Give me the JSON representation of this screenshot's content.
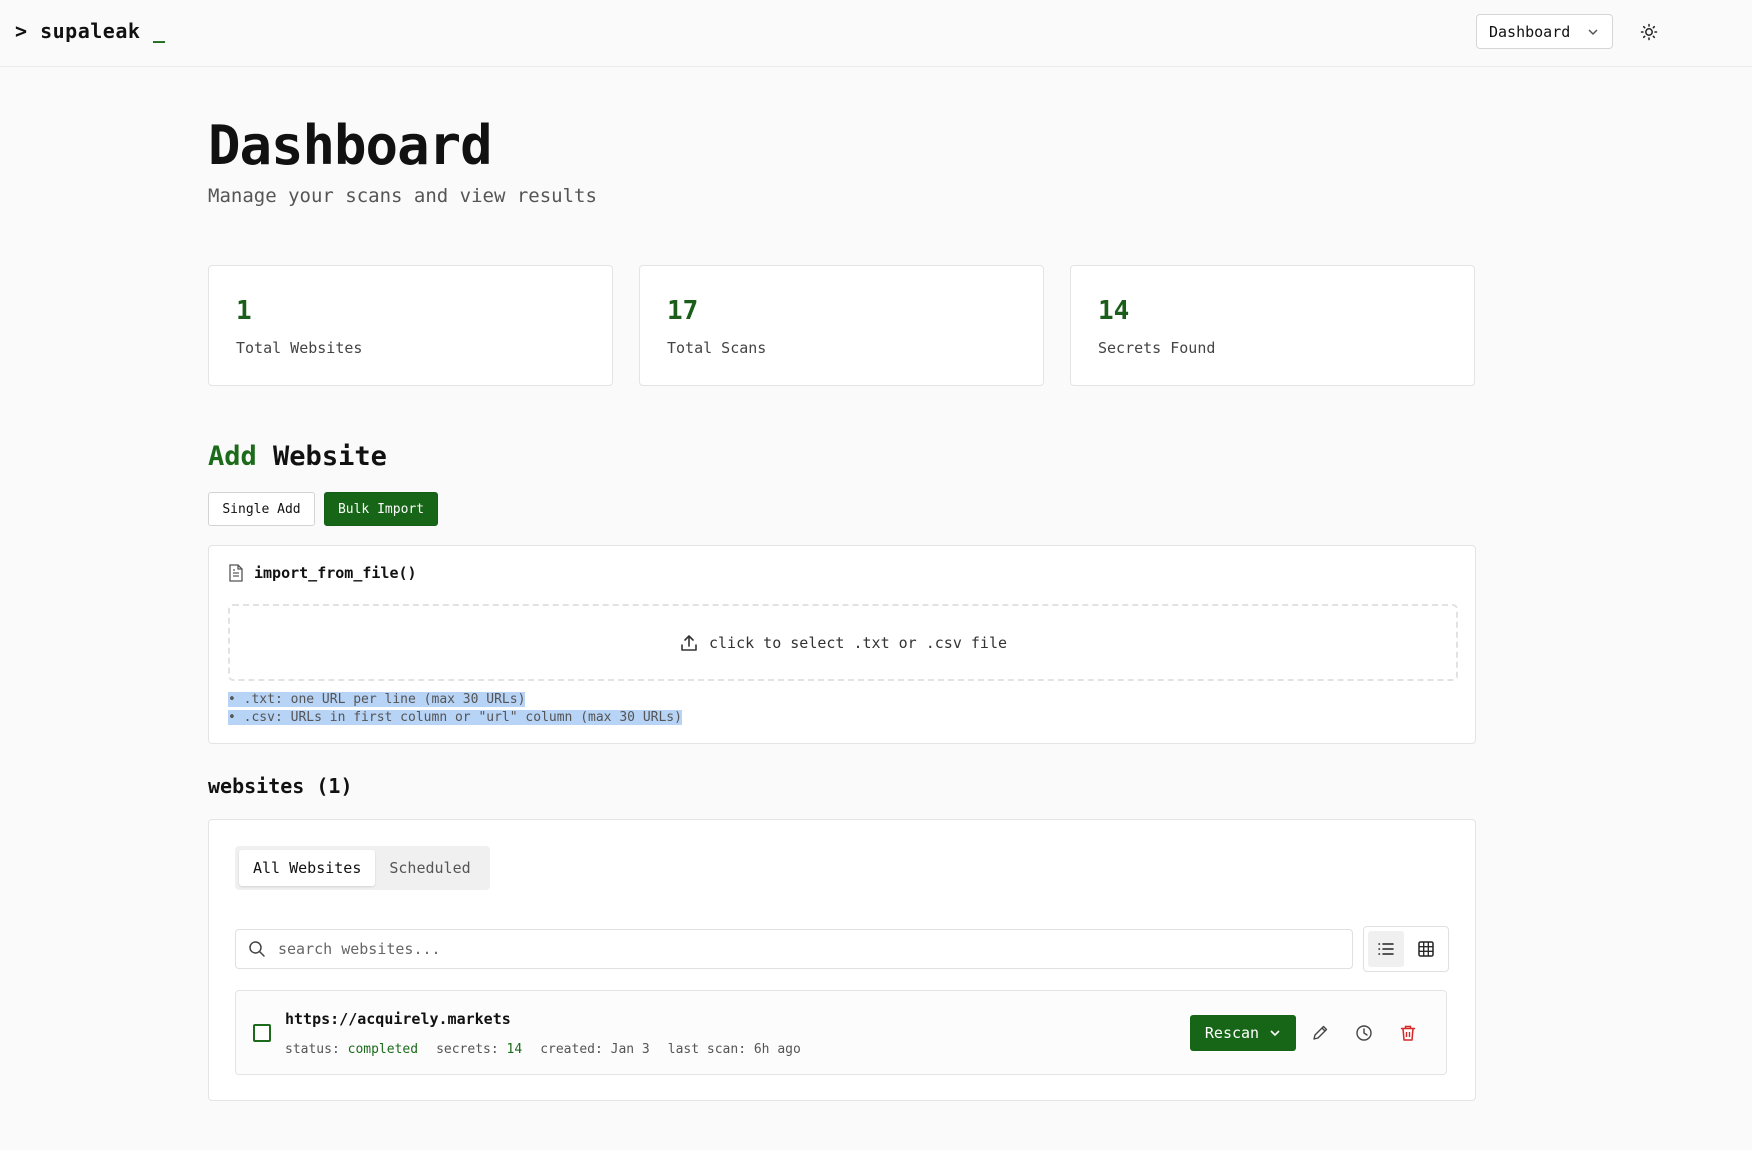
{
  "header": {
    "logo_prompt": ">",
    "logo_name": "supaleak",
    "logo_cursor": "_",
    "nav_select_value": "Dashboard"
  },
  "page": {
    "title": "Dashboard",
    "subtitle": "Manage your scans and view results"
  },
  "stats": [
    {
      "value": "1",
      "label": "Total Websites"
    },
    {
      "value": "17",
      "label": "Total Scans"
    },
    {
      "value": "14",
      "label": "Secrets Found"
    }
  ],
  "add_website": {
    "title_accent": "Add",
    "title_rest": "Website",
    "single_label": "Single Add",
    "bulk_label": "Bulk Import",
    "import_heading": "import_from_file()",
    "dropzone_text": "click to select .txt or .csv file",
    "hint_txt": "• .txt: one URL per line (max 30 URLs)",
    "hint_csv": "• .csv: URLs in first column or \"url\" column (max 30 URLs)"
  },
  "websites": {
    "title": "websites (1)",
    "tabs": [
      "All Websites",
      "Scheduled"
    ],
    "search_placeholder": "search websites...",
    "rows": [
      {
        "url": "https://acquirely.markets",
        "status_label": "status:",
        "status": "completed",
        "secrets_label": "secrets:",
        "secrets": "14",
        "created": "created: Jan 3",
        "last_scan": "last scan: 6h ago",
        "rescan_label": "Rescan"
      }
    ]
  },
  "colors": {
    "accent": "#176617",
    "stat_value": "#1b5e1b",
    "danger": "#d62828",
    "selection": "#b7d3f5"
  }
}
